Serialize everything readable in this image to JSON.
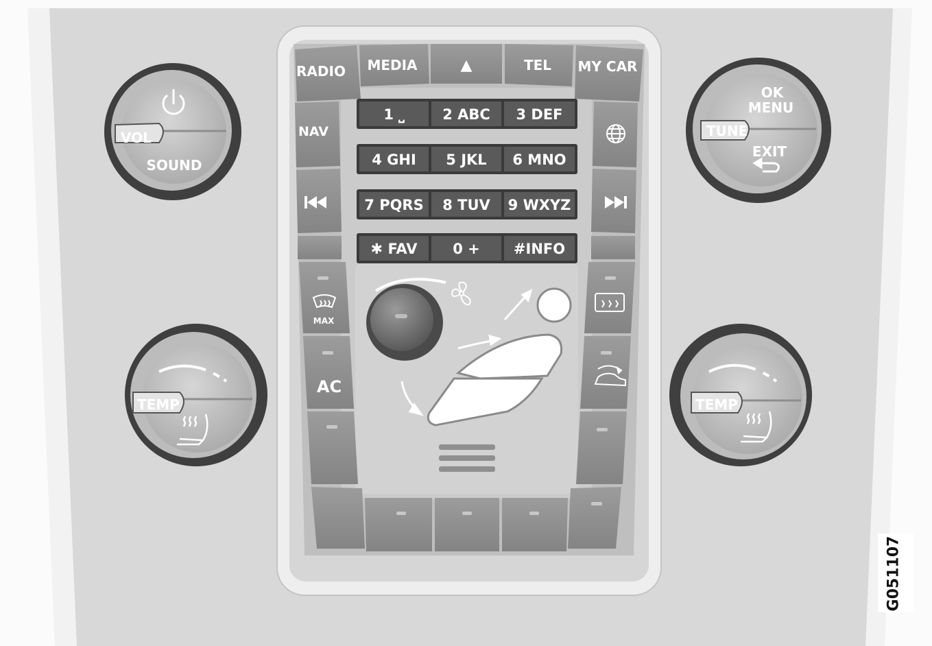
{
  "top_buttons": {
    "radio": "RADIO",
    "media": "MEDIA",
    "eject": "▲",
    "tel": "TEL",
    "my_car": "MY CAR"
  },
  "side_buttons": {
    "nav": "NAV",
    "globe_icon": "globe-icon",
    "prev_icon": "skip-back-icon",
    "next_icon": "skip-forward-icon"
  },
  "keypad": [
    [
      "1 ⎵",
      "2 ABC",
      "3 DEF"
    ],
    [
      "4 GHI",
      "5 JKL",
      "6 MNO"
    ],
    [
      "7 PQRS",
      "8 TUV",
      "9 WXYZ"
    ],
    [
      "✱ FAV",
      "0 +",
      "#INFO"
    ]
  ],
  "left_vol_knob": {
    "vol": "VOL",
    "sound": "SOUND",
    "power_icon": "power-icon"
  },
  "right_tune_knob": {
    "ok": "OK",
    "menu": "MENU",
    "tune": "TUNE",
    "exit": "EXIT",
    "back_icon": "return-arrow-icon"
  },
  "climate": {
    "defrost_max": "MAX",
    "ac": "AC",
    "left_temp": "TEMP",
    "right_temp": "TEMP",
    "fan_icon": "fan-icon",
    "rear_defrost_icon": "rear-defrost-icon",
    "recirculation_icon": "recirculation-icon",
    "seat_heat_icon": "seat-heat-icon"
  },
  "figure_code": "G051107",
  "colors": {
    "panel": "#d7d7d7",
    "button": "#8f8f8f",
    "keypad_key": "#5a5a5a",
    "knob_ring": "#3f3f3f",
    "knob_face": "#bdbdbd"
  }
}
